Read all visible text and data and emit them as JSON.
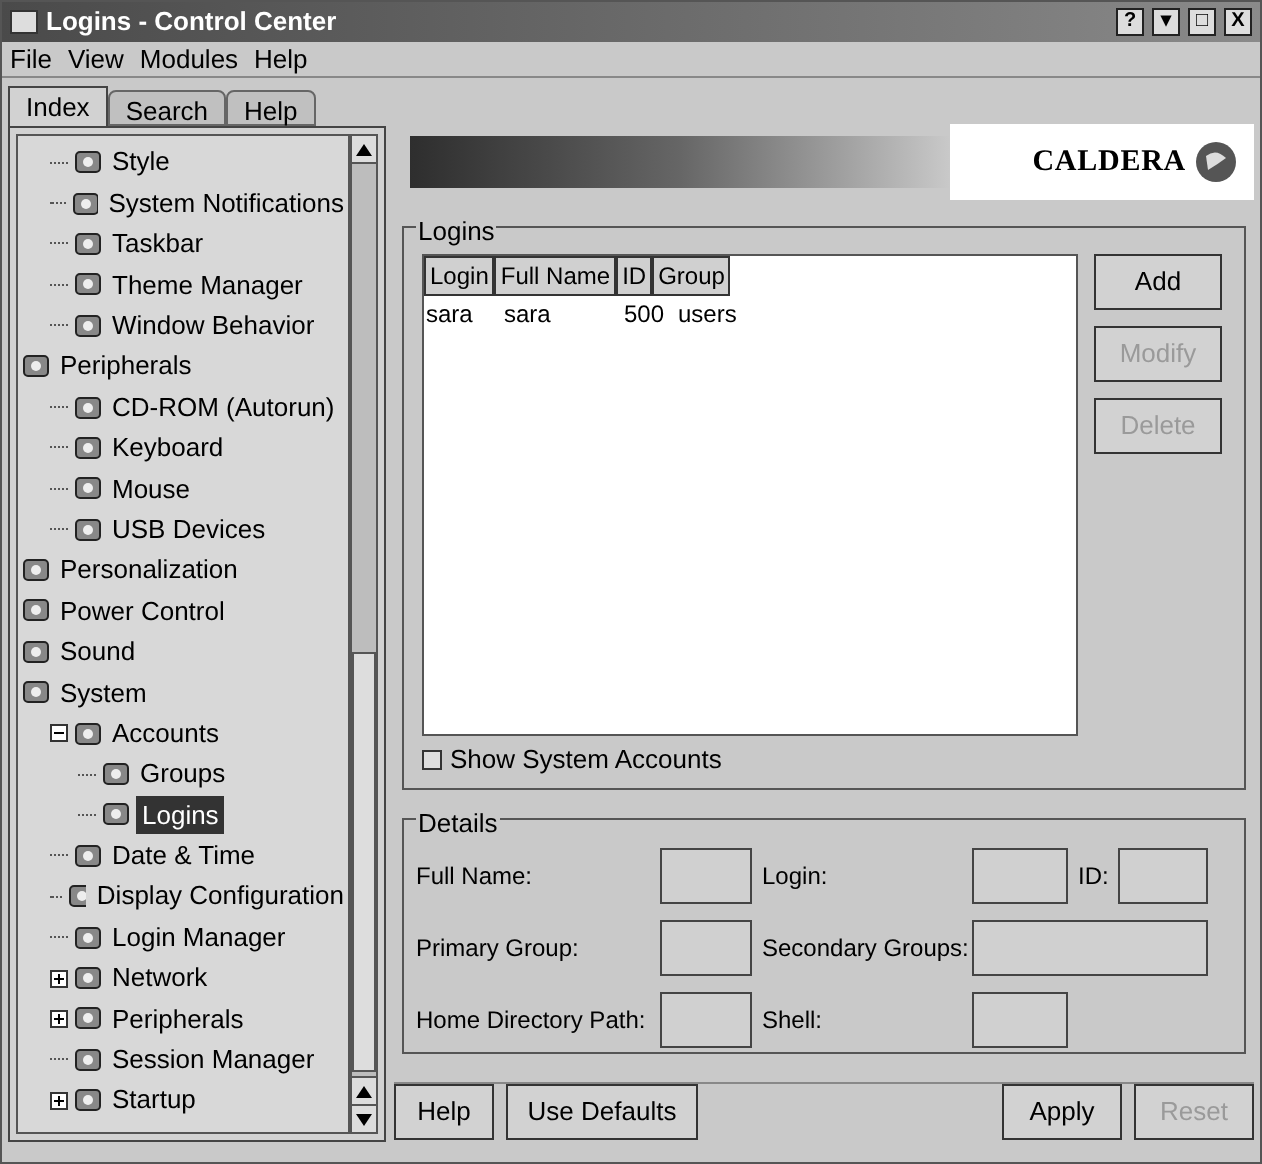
{
  "window": {
    "title": "Logins - Control Center",
    "controls": [
      "?",
      "▾",
      "□",
      "X"
    ]
  },
  "menu": [
    "File",
    "View",
    "Modules",
    "Help"
  ],
  "sidebar_tabs": [
    {
      "label": "Index",
      "selected": true
    },
    {
      "label": "Search",
      "selected": false
    },
    {
      "label": "Help",
      "selected": false
    }
  ],
  "tree_continued": [
    {
      "label": "Style"
    },
    {
      "label": "System Notifications"
    },
    {
      "label": "Taskbar"
    },
    {
      "label": "Theme Manager"
    },
    {
      "label": "Window Behavior"
    }
  ],
  "tree": [
    {
      "label": "Peripherals",
      "children": [
        {
          "label": "CD-ROM (Autorun)"
        },
        {
          "label": "Keyboard"
        },
        {
          "label": "Mouse"
        },
        {
          "label": "USB Devices"
        }
      ]
    },
    {
      "label": "Personalization"
    },
    {
      "label": "Power Control"
    },
    {
      "label": "Sound"
    },
    {
      "label": "System",
      "children": [
        {
          "label": "Accounts",
          "expanded": true,
          "children": [
            {
              "label": "Groups",
              "selected": false
            },
            {
              "label": "Logins",
              "selected": true
            }
          ]
        },
        {
          "label": "Date & Time"
        },
        {
          "label": "Display Configuration"
        },
        {
          "label": "Login Manager"
        },
        {
          "label": "Network",
          "expanded": false
        },
        {
          "label": "Peripherals",
          "expanded": false
        },
        {
          "label": "Session Manager"
        },
        {
          "label": "Startup",
          "expanded": false
        }
      ]
    }
  ],
  "banner": {
    "logo": "CALDERA"
  },
  "logins": {
    "title": "Logins",
    "columns": [
      "Login",
      "Full Name",
      "ID",
      "Group"
    ],
    "rows": [
      [
        "sara",
        "sara",
        "500",
        "users"
      ]
    ],
    "buttons": [
      {
        "label": "Add",
        "disabled": false
      },
      {
        "label": "Modify",
        "disabled": true
      },
      {
        "label": "Delete",
        "disabled": true
      }
    ],
    "show_system_accounts": {
      "label": "Show System Accounts",
      "checked": false
    }
  },
  "details": {
    "title": "Details",
    "fields": [
      {
        "label": "Full Name:"
      },
      {
        "label": "Login:"
      },
      {
        "label": "ID:"
      },
      {
        "label": "Primary Group:"
      },
      {
        "label": "Secondary Groups:"
      },
      {
        "label": "Home Directory Path:"
      },
      {
        "label": "Shell:"
      }
    ]
  },
  "footer_buttons": [
    {
      "label": "Help",
      "disabled": false
    },
    {
      "label": "Use Defaults",
      "disabled": false
    },
    {
      "label": "Apply",
      "disabled": false
    },
    {
      "label": "Reset",
      "disabled": true
    }
  ]
}
